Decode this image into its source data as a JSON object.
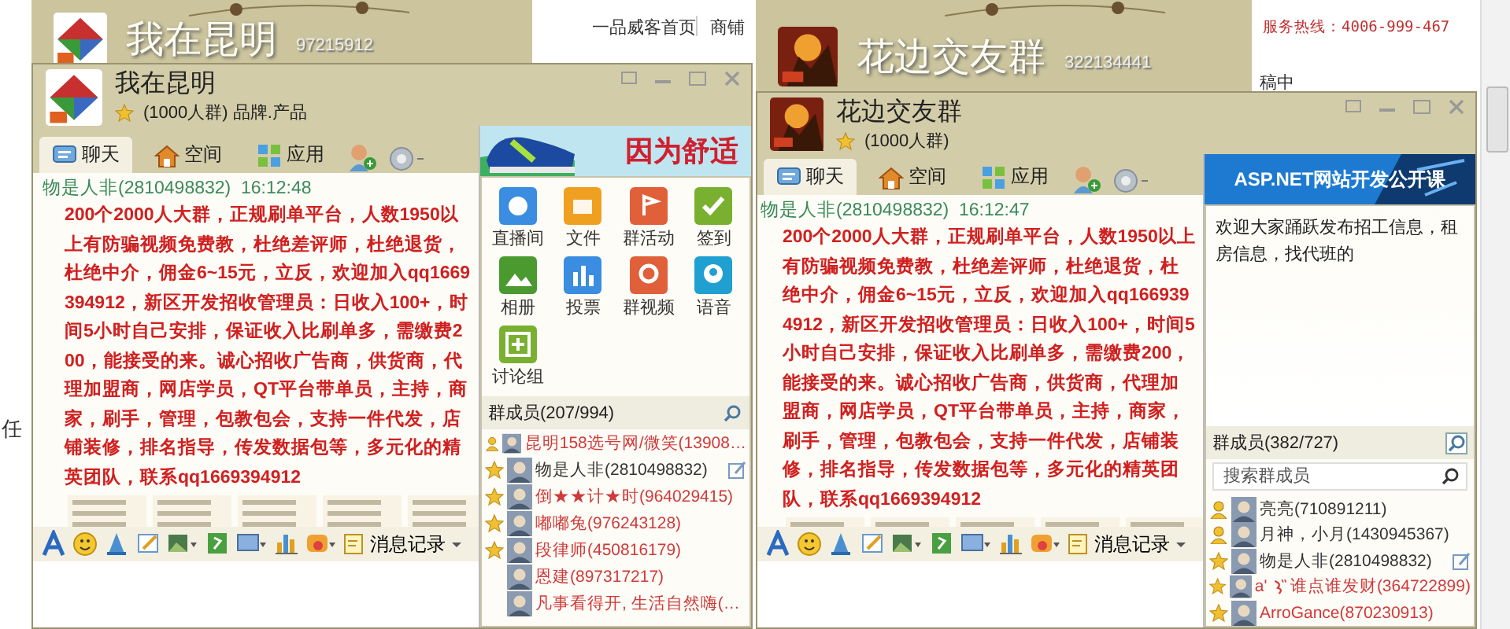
{
  "background_page": {
    "links": [
      "一品威客首页",
      "商铺"
    ],
    "hotline": "服务热线：4006-999-467",
    "status": "稿中",
    "side_label": "任"
  },
  "windows": [
    {
      "back": {
        "name": "我在昆明",
        "number": "97215912"
      },
      "front": {
        "name": "我在昆明",
        "subtitle": "(1000人群) 品牌.产品",
        "tabs": [
          {
            "label": "聊天",
            "selected": true
          },
          {
            "label": "空间",
            "selected": false
          },
          {
            "label": "应用",
            "selected": false
          }
        ],
        "ad": {
          "kind": "shoe",
          "text": "因为舒适"
        },
        "message": {
          "sender": "物是人非(2810498832)",
          "time": "16:12:48",
          "text": "200个2000人大群，正规刷单平台，人数1950以上有防骗视频免费教，杜绝差评师，杜绝退货，杜绝中介，佣金6~15元，立反，欢迎加入qq1669394912，新区开发招收管理员：日收入100+，时间5小时自己安排，保证收入比刷单多，需缴费200，能接受的来。诚心招收广告商，供货商，代理加盟商，网店学员，QT平台带单员，主持，商家，刷手，管理，包教包会，支持一件代发，店铺装修，排名指导，传发数据包等，多元化的精英团队，联系qq1669394912"
        },
        "history_label": "消息记录",
        "side": {
          "kind": "apps",
          "apps": [
            "直播间",
            "文件",
            "群活动",
            "签到",
            "相册",
            "投票",
            "群视频",
            "语音",
            "讨论组"
          ]
        },
        "members_title": "群成员(207/994)",
        "members": [
          {
            "name": "昆明158选号网/微笑(13908…",
            "kind": "owner",
            "color": "#d03a3a",
            "editable": false
          },
          {
            "name": "物是人非(2810498832)",
            "kind": "admin",
            "color": "#333333",
            "editable": true
          },
          {
            "name": "倒★★计★时(964029415)",
            "kind": "admin",
            "color": "#d03a3a",
            "editable": false
          },
          {
            "name": "嘟嘟兔(976243128)",
            "kind": "admin",
            "color": "#d03a3a",
            "editable": false
          },
          {
            "name": "段律师(450816179)",
            "kind": "admin",
            "color": "#d03a3a",
            "editable": false
          },
          {
            "name": "恩建(897317217)",
            "kind": "member",
            "color": "#d03a3a",
            "editable": false
          },
          {
            "name": "凡事看得开, 生活自然嗨(…",
            "kind": "member",
            "color": "#d03a3a",
            "editable": false
          }
        ]
      }
    },
    {
      "back": {
        "name": "花边交友群",
        "number": "322134441"
      },
      "front": {
        "name": "花边交友群",
        "subtitle": "(1000人群)",
        "tabs": [
          {
            "label": "聊天",
            "selected": true
          },
          {
            "label": "空间",
            "selected": false
          },
          {
            "label": "应用",
            "selected": false
          }
        ],
        "ad": {
          "kind": "course",
          "text": "ASP.NET网站开发公开课"
        },
        "message": {
          "sender": "物是人非(2810498832)",
          "time": "16:12:47",
          "text": "200个2000人大群，正规刷单平台，人数1950以上有防骗视频免费教，杜绝差评师，杜绝退货，杜绝中介，佣金6~15元，立反，欢迎加入qq1669394912，新区开发招收管理员：日收入100+，时间5小时自己安排，保证收入比刷单多，需缴费200，能接受的来。诚心招收广告商，供货商，代理加盟商，网店学员，QT平台带单员，主持，商家，刷手，管理，包教包会，支持一件代发，店铺装修，排名指导，传发数据包等，多元化的精英团队，联系qq1669394912"
        },
        "history_label": "消息记录",
        "side": {
          "kind": "notice",
          "notice": "欢迎大家踊跃发布招工信息，租房信息，找代班的"
        },
        "members_title": "群成员(382/727)",
        "search": {
          "placeholder": "搜索群成员"
        },
        "members": [
          {
            "name": "亮亮(710891211)",
            "kind": "owner",
            "color": "#333333",
            "editable": false
          },
          {
            "name": "月神，小月(1430945367)",
            "kind": "owner",
            "color": "#333333",
            "editable": false
          },
          {
            "name": "物是人非(2810498832)",
            "kind": "admin",
            "color": "#333333",
            "editable": true
          },
          {
            "tag": "a'",
            "name": "谁点谁发财(364722899)",
            "kind": "admin",
            "color": "#d03a3a",
            "editable": false
          },
          {
            "name": "ArroGance(870230913)",
            "kind": "admin",
            "color": "#d03a3a",
            "editable": false
          }
        ]
      }
    }
  ]
}
